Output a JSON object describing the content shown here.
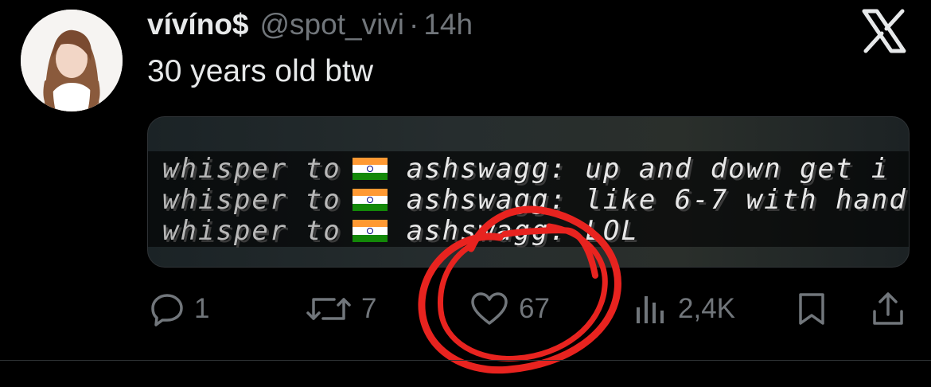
{
  "tweet": {
    "display_name": "vívíno$",
    "handle": "@spot_vivi",
    "separator": "·",
    "time": "14h",
    "text": "30 years old btw"
  },
  "media": {
    "lines": [
      {
        "prefix": "whisper to",
        "username": "ashswagg",
        "message": ": up and down get i"
      },
      {
        "prefix": "whisper to",
        "username": "ashswagg",
        "message": ": like 6-7 with hand"
      },
      {
        "prefix": "whisper to",
        "username": "ashswagg",
        "message": ": LOL"
      }
    ]
  },
  "actions": {
    "replies": "1",
    "reposts": "7",
    "likes": "67",
    "views": "2,4K"
  },
  "icons": {
    "logo": "x-logo-icon",
    "reply": "reply-icon",
    "repost": "repost-icon",
    "like": "heart-icon",
    "views": "views-icon",
    "bookmark": "bookmark-icon",
    "share": "share-icon",
    "flag": "india-flag-icon"
  },
  "colors": {
    "background": "#000000",
    "text": "#e7e9ea",
    "muted": "#71767b",
    "annotation": "#e8231f"
  }
}
